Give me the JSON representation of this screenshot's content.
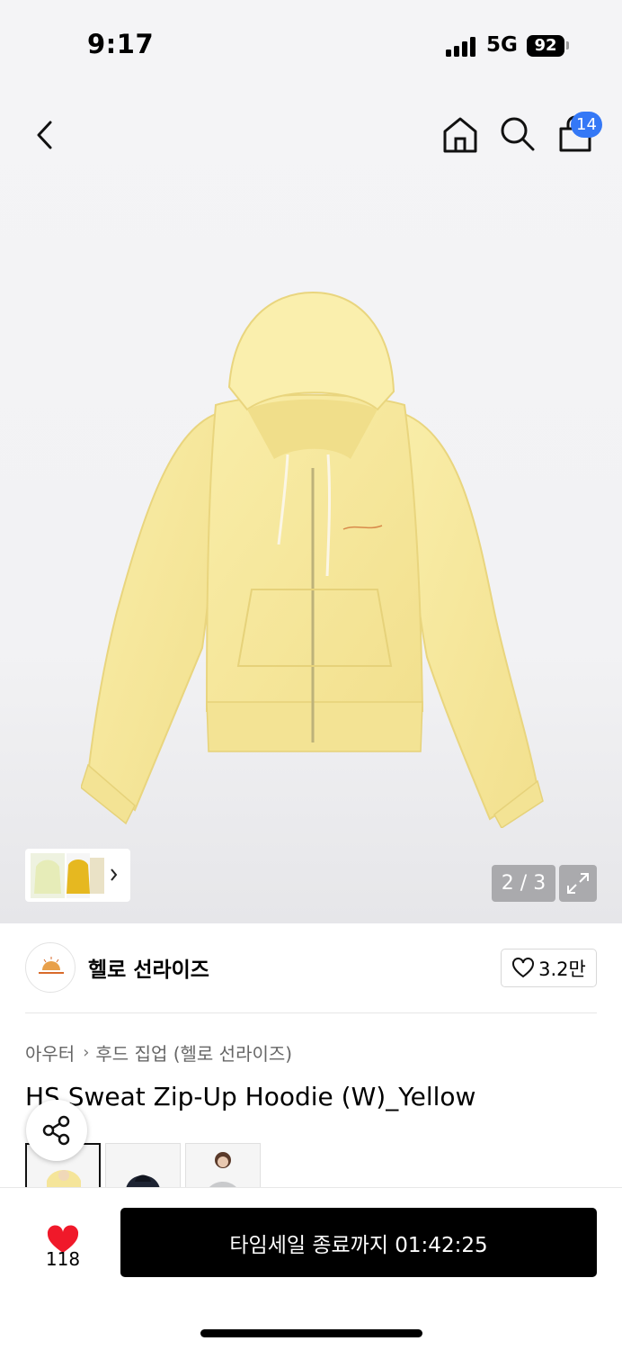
{
  "status_bar": {
    "time": "9:17",
    "network": "5G",
    "battery": "92"
  },
  "nav": {
    "cart_count": "14"
  },
  "gallery": {
    "pager": "2 / 3"
  },
  "brand": {
    "name": "헬로 선라이즈",
    "likes": "3.2만"
  },
  "breadcrumb": {
    "category": "아우터",
    "subcategory": "후드 집업 (헬로 선라이즈)"
  },
  "product": {
    "title": "HS Sweat Zip-Up Hoodie (W)_Yellow"
  },
  "bottom_bar": {
    "favorite_count": "118",
    "buy_label": "타임세일 종료까지 01:42:25"
  },
  "colors": {
    "accent": "#3478f6",
    "heart": "#f0192a",
    "hoodie": "#f7eaa0"
  }
}
